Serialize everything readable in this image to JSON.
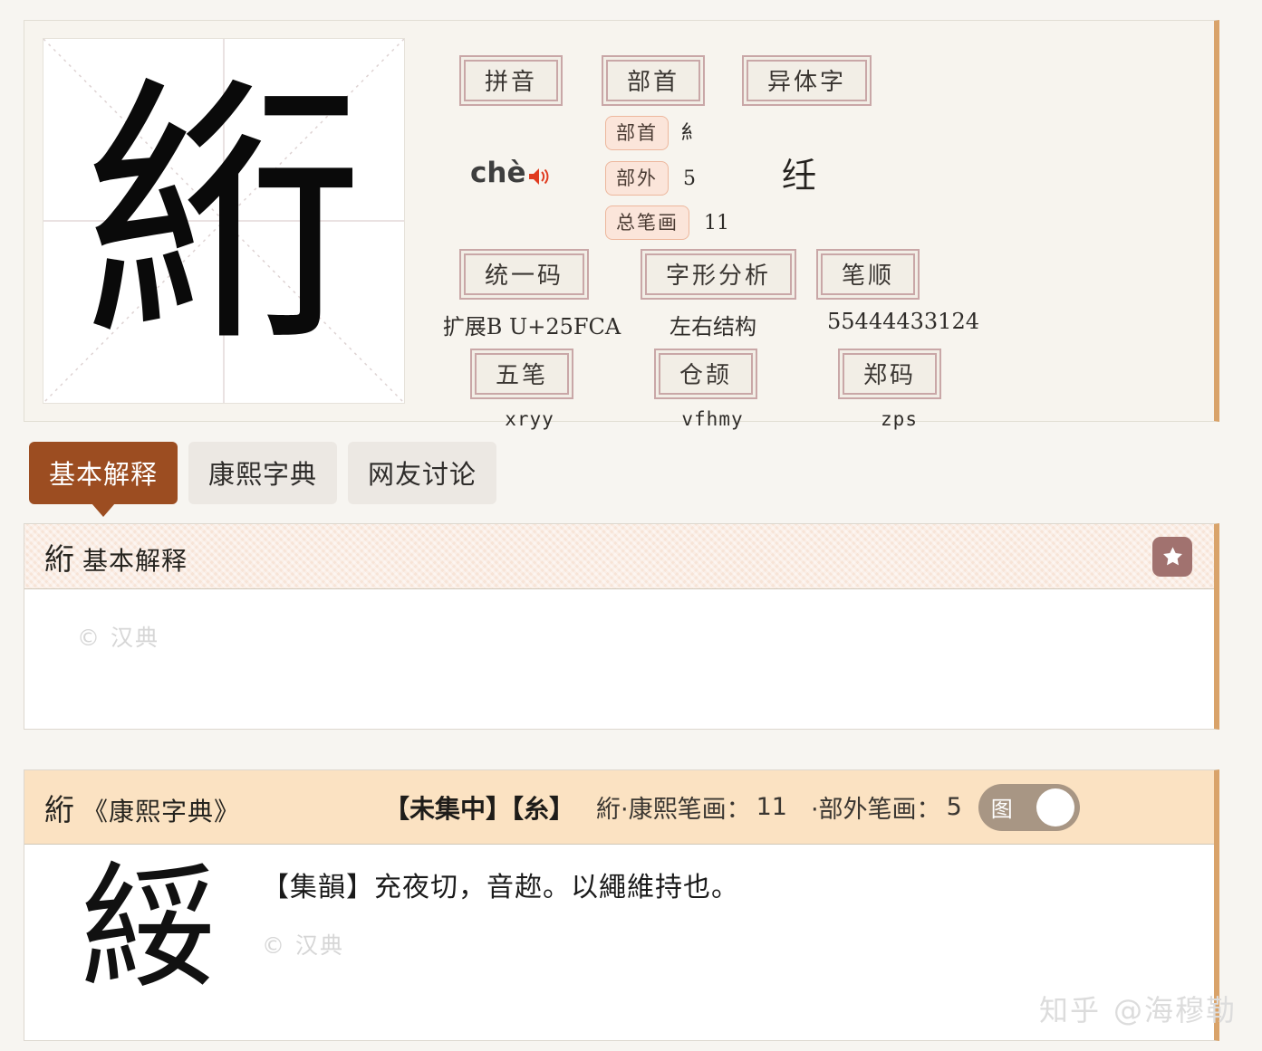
{
  "character": {
    "glyph": "絎",
    "simplified_variant": "纴",
    "kangxi_glyph": "絎"
  },
  "info": {
    "sections": [
      {
        "title": "拼音",
        "value": "chè"
      },
      {
        "title": "部首",
        "value": ""
      },
      {
        "title": "异体字",
        "value": "纴"
      }
    ],
    "pinyin": "chè",
    "radical_rows": [
      {
        "label": "部首",
        "value": "糹"
      },
      {
        "label": "部外",
        "value": "5"
      },
      {
        "label": "总笔画",
        "value": "11"
      }
    ],
    "codes": [
      {
        "title": "统一码",
        "value": "扩展B  U+25FCA"
      },
      {
        "title": "字形分析",
        "value": "左右结构"
      },
      {
        "title": "笔顺",
        "value": "55444433124"
      }
    ],
    "inputs": [
      {
        "title": "五笔",
        "value": "xryy"
      },
      {
        "title": "仓颉",
        "value": "vfhmy"
      },
      {
        "title": "郑码",
        "value": "zps"
      }
    ]
  },
  "tabs": [
    {
      "label": "基本解释",
      "active": true
    },
    {
      "label": "康熙字典",
      "active": false
    },
    {
      "label": "网友讨论",
      "active": false
    }
  ],
  "basic": {
    "head_char": "絎",
    "head_label": "基本解释",
    "watermark": "© 汉典",
    "star_icon": "star-icon"
  },
  "kangxi": {
    "head_char": "絎",
    "book": "《康熙字典》",
    "section": "【未集中】【糸】",
    "stroke_label": "絎·康熙笔画：",
    "stroke_value": "11",
    "outer_label": "·部外笔画：",
    "outer_value": "5",
    "toggle_label": "图",
    "body_text": "【集韻】充夜切，音趂。以繩維持也。",
    "watermark": "© 汉典"
  },
  "watermark": {
    "brand": "知乎",
    "user": "@海穆勒"
  },
  "colors": {
    "accent_brown": "#9c4d21",
    "panel_edge": "#d9a36a",
    "frame_border": "#c9a7a7",
    "pill_bg": "#fbe5da",
    "kangxi_head": "#fbe2c2",
    "basic_head": "#f7e4d7",
    "speaker": "#e03a1e"
  }
}
